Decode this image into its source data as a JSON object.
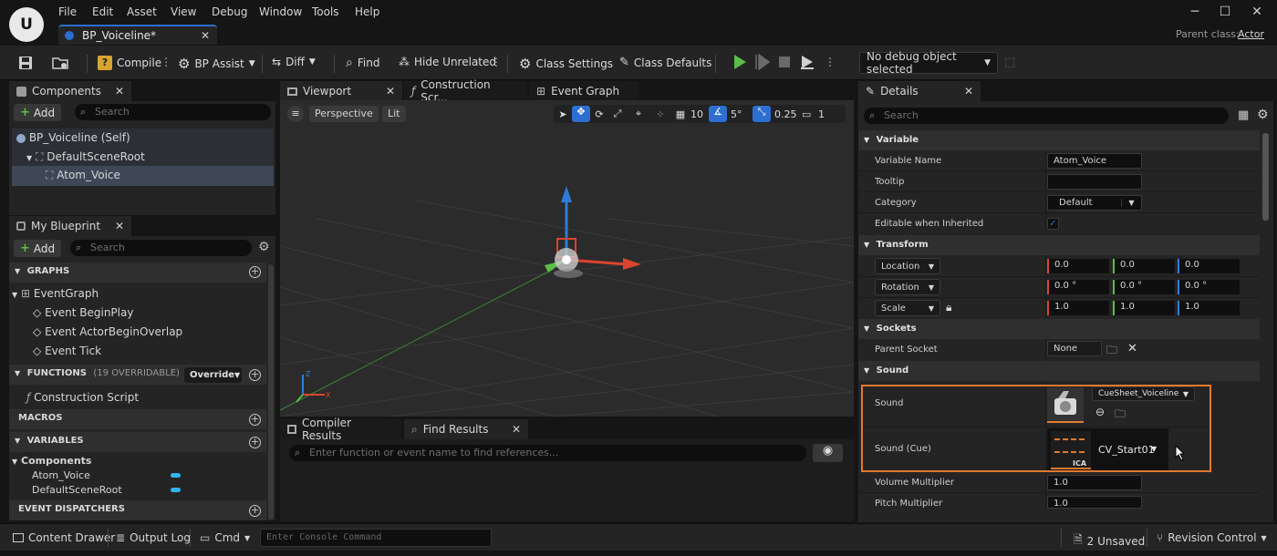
{
  "menu": [
    "File",
    "Edit",
    "Asset",
    "View",
    "Debug",
    "Window",
    "Tools",
    "Help"
  ],
  "tab": {
    "title": "BP_Voiceline*"
  },
  "parent_class": {
    "label": "Parent class:",
    "value": "Actor"
  },
  "toolbar": {
    "compile": "Compile",
    "bp_assist": "BP Assist",
    "diff": "Diff",
    "find": "Find",
    "hide_unrelated": "Hide Unrelated",
    "class_settings": "Class Settings",
    "class_defaults": "Class Defaults",
    "debug_object": "No debug object selected"
  },
  "components": {
    "tab": "Components",
    "add": "Add",
    "search_placeholder": "Search",
    "items": [
      "BP_Voiceline (Self)",
      "DefaultSceneRoot",
      "Atom_Voice"
    ]
  },
  "my_blueprint": {
    "tab": "My Blueprint",
    "add": "Add",
    "search_placeholder": "Search",
    "graphs_header": "GRAPHS",
    "event_graph": "EventGraph",
    "events": [
      "Event BeginPlay",
      "Event ActorBeginOverlap",
      "Event Tick"
    ],
    "functions_header": "FUNCTIONS",
    "functions_count": "(19 OVERRIDABLE)",
    "override": "Override",
    "construction_script": "Construction Script",
    "macros_header": "MACROS",
    "variables_header": "VARIABLES",
    "components_group": "Components",
    "variables": [
      "Atom_Voice",
      "DefaultSceneRoot"
    ],
    "dispatchers_header": "EVENT DISPATCHERS"
  },
  "editor_tabs": {
    "viewport": "Viewport",
    "construction": "Construction Scr...",
    "event_graph": "Event Graph"
  },
  "viewport": {
    "perspective": "Perspective",
    "lit": "Lit",
    "grid": "10",
    "angle": "5°",
    "scale": "0.25",
    "camera": "1"
  },
  "results": {
    "compiler": "Compiler Results",
    "find": "Find Results",
    "search_placeholder": "Enter function or event name to find references..."
  },
  "details": {
    "tab": "Details",
    "search_placeholder": "Search",
    "variable_header": "Variable",
    "variable_name_label": "Variable Name",
    "variable_name": "Atom_Voice",
    "tooltip_label": "Tooltip",
    "tooltip": "",
    "category_label": "Category",
    "category": "Default",
    "editable_label": "Editable when Inherited",
    "editable": true,
    "transform_header": "Transform",
    "location_label": "Location",
    "rotation_label": "Rotation",
    "scale_label": "Scale",
    "location": [
      "0.0",
      "0.0",
      "0.0"
    ],
    "rotation": [
      "0.0 °",
      "0.0 °",
      "0.0 °"
    ],
    "scale": [
      "1.0",
      "1.0",
      "1.0"
    ],
    "sockets_header": "Sockets",
    "parent_socket_label": "Parent Socket",
    "parent_socket": "None",
    "sound_header": "Sound",
    "sound_label": "Sound",
    "sound_asset": "CueSheet_Voiceline",
    "sound_cue_label": "Sound (Cue)",
    "sound_cue": "CV_Start01",
    "cue_thumb_text": "ICA",
    "volume_label": "Volume Multiplier",
    "volume": "1.0",
    "pitch_label": "Pitch Multiplier",
    "pitch": "1.0"
  },
  "statusbar": {
    "content_drawer": "Content Drawer",
    "output_log": "Output Log",
    "cmd": "Cmd",
    "console_placeholder": "Enter Console Command",
    "unsaved": "2 Unsaved",
    "revision_control": "Revision Control"
  },
  "colors": {
    "accent": "#2d6fd1",
    "highlight_box": "#e07a2f",
    "play": "#5cbd47",
    "x_axis": "#d8452e",
    "y_axis": "#5cbd47",
    "z_axis": "#2e7bd8"
  }
}
